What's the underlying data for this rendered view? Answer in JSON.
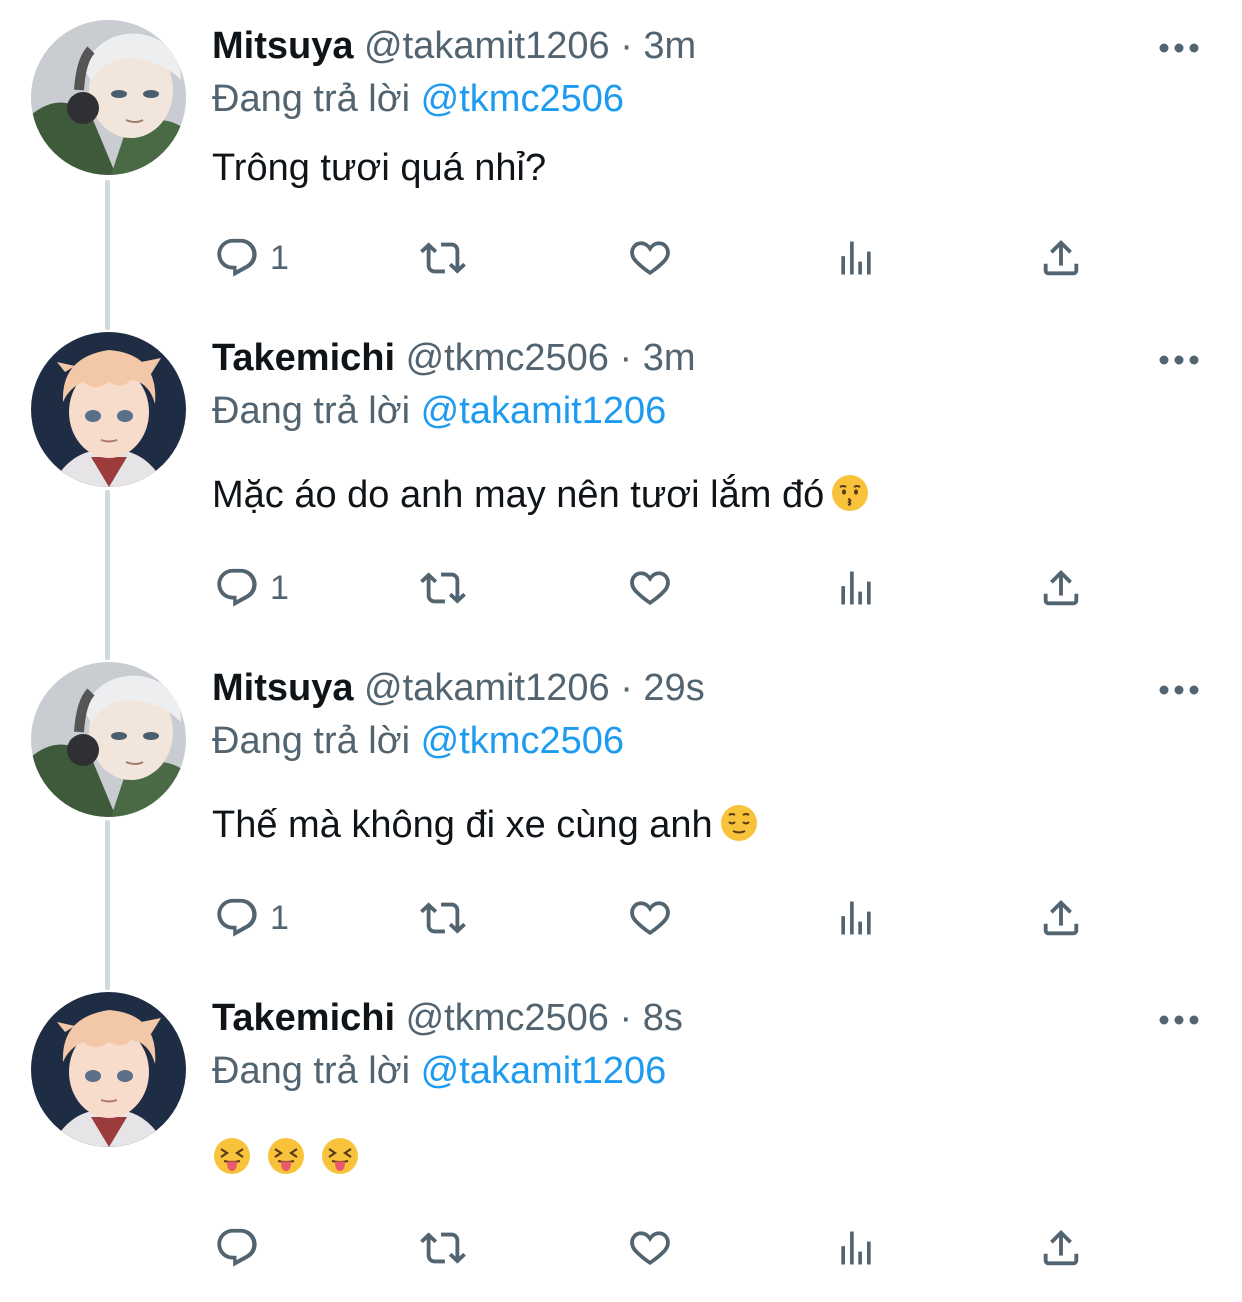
{
  "thread": [
    {
      "name": "Mitsuya",
      "handle": "@takamit1206",
      "separator": "·",
      "time": "3m",
      "replying_prefix": "Đang trả lời",
      "replying_to": "@tkmc2506",
      "text": "Trông tươi quá nhỉ?",
      "emoji": [],
      "reply_count": "1",
      "avatar_icon": "mitsuya-avatar"
    },
    {
      "name": "Takemichi",
      "handle": "@tkmc2506",
      "separator": "·",
      "time": "3m",
      "replying_prefix": "Đang trả lời",
      "replying_to": "@takamit1206",
      "text": "Mặc áo do anh may nên tươi lắm đó",
      "emoji": [
        "kissing-face"
      ],
      "reply_count": "1",
      "avatar_icon": "takemichi-avatar"
    },
    {
      "name": "Mitsuya",
      "handle": "@takamit1206",
      "separator": "·",
      "time": "29s",
      "replying_prefix": "Đang trả lời",
      "replying_to": "@tkmc2506",
      "text": "Thế mà không đi xe cùng anh",
      "emoji": [
        "relieved-face"
      ],
      "reply_count": "1",
      "avatar_icon": "mitsuya-avatar"
    },
    {
      "name": "Takemichi",
      "handle": "@tkmc2506",
      "separator": "·",
      "time": "8s",
      "replying_prefix": "Đang trả lời",
      "replying_to": "@takamit1206",
      "text": "",
      "emoji": [
        "squinting-tongue-face",
        "squinting-tongue-face",
        "squinting-tongue-face"
      ],
      "reply_count": "",
      "avatar_icon": "takemichi-avatar"
    }
  ],
  "icons": {
    "reply": "reply-icon",
    "retweet": "retweet-icon",
    "like": "heart-icon",
    "views": "views-icon",
    "share": "share-icon",
    "more": "more-icon"
  },
  "colors": {
    "text": "#0f1419",
    "secondary": "#536471",
    "link": "#1d9bf0",
    "thread_line": "#cfd9de"
  }
}
